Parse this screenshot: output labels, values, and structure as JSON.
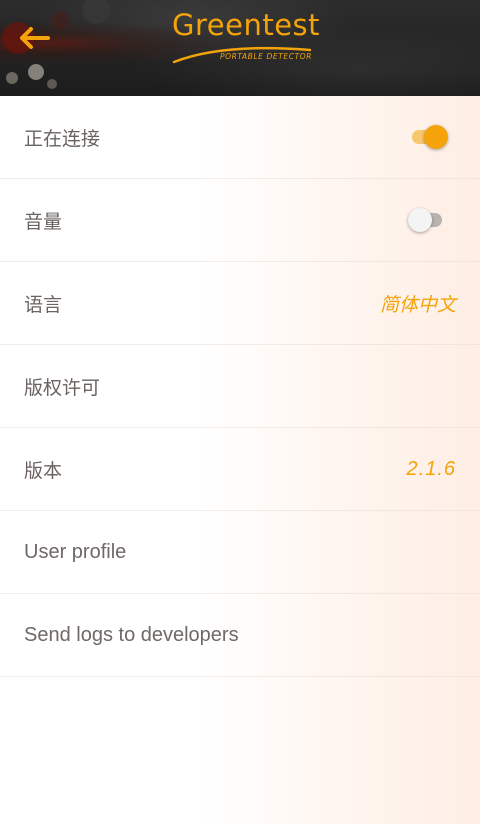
{
  "header": {
    "back_icon": "arrow-left-icon",
    "logo_title": "Greentest",
    "logo_subtitle": "PORTABLE DETECTOR"
  },
  "settings": {
    "connecting_label": "正在连接",
    "connecting_on": true,
    "volume_label": "音量",
    "volume_on": false,
    "language_label": "语言",
    "language_value": "简体中文",
    "license_label": "版权许可",
    "version_label": "版本",
    "version_value": "2.1.6",
    "user_profile_label": "User profile",
    "send_logs_label": "Send logs to developers"
  },
  "colors": {
    "accent": "#f4a30a",
    "header_bg": "#222222",
    "label_text": "#6a6360",
    "toggle_off_track": "#b8b3b0"
  }
}
